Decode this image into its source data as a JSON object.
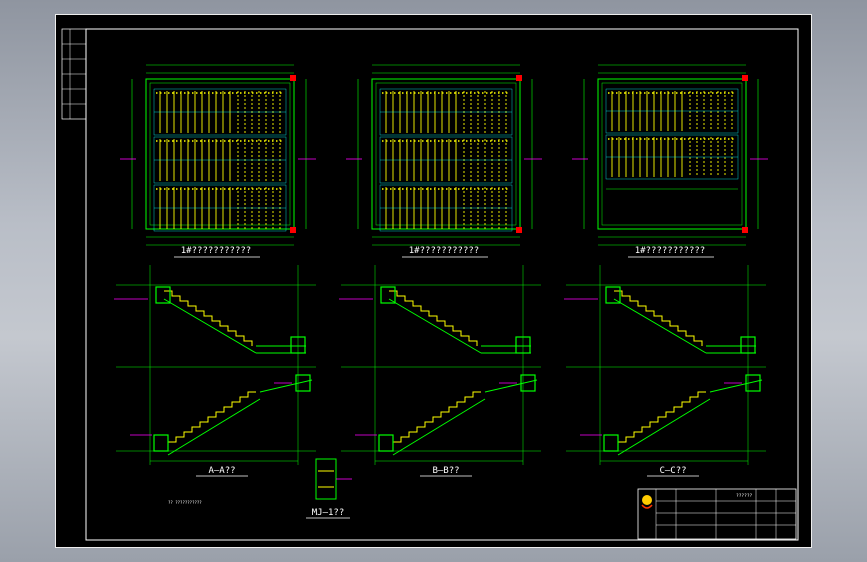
{
  "drawing": {
    "plan_titles": [
      "1#???????????",
      "1#???????????",
      "1#???????????"
    ],
    "section_titles": [
      "A—A??",
      "B—B??",
      "C—C??"
    ],
    "detail_title": "MJ—1??",
    "note": "?? ???????????",
    "title_block_text": "??????"
  },
  "colors": {
    "background": "#000000",
    "frame": "#ffffff",
    "structure": "#00ff00",
    "rebar": "#ffff00",
    "dimension": "#00ffff",
    "accent": "#ff00ff",
    "marker": "#ff0000"
  }
}
